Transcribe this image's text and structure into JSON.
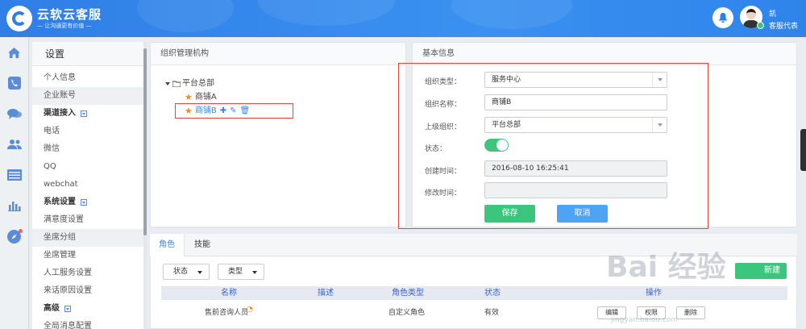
{
  "header": {
    "brand_title": "云软云客服",
    "brand_slogan": "— 让沟通更有价值 —",
    "user_name": "凯",
    "user_role": "客服代表"
  },
  "rail": {
    "icons": [
      "home-icon",
      "phone-icon",
      "chat-icon",
      "users-icon",
      "list-icon",
      "bar-chart-icon",
      "compass-icon"
    ]
  },
  "menu": {
    "title": "设置",
    "items": [
      {
        "label": "个人信息",
        "type": "item"
      },
      {
        "label": "企业账号",
        "type": "item",
        "active": true
      },
      {
        "label": "渠道接入",
        "type": "group"
      },
      {
        "label": "电话",
        "type": "item"
      },
      {
        "label": "微信",
        "type": "item"
      },
      {
        "label": "QQ",
        "type": "item"
      },
      {
        "label": "webchat",
        "type": "item"
      },
      {
        "label": "系统设置",
        "type": "group"
      },
      {
        "label": "满意度设置",
        "type": "item"
      },
      {
        "label": "坐席分组",
        "type": "item",
        "active": true
      },
      {
        "label": "坐席管理",
        "type": "item"
      },
      {
        "label": "人工服务设置",
        "type": "item"
      },
      {
        "label": "来话原因设置",
        "type": "item"
      },
      {
        "label": "高级",
        "type": "group"
      },
      {
        "label": "全局消息配置",
        "type": "item"
      }
    ]
  },
  "org_panel": {
    "title": "组织管理机构",
    "root": "平台总部",
    "child_a": "商铺A",
    "child_b": "商铺B"
  },
  "info_panel": {
    "title": "基本信息",
    "type_label": "组织类型：",
    "type_value": "服务中心",
    "name_label": "组织名称：",
    "name_value": "商铺B",
    "parent_label": "上级组织：",
    "parent_value": "平台总部",
    "status_label": "状态：",
    "status_on": true,
    "created_label": "创建时间：",
    "created_value": "2016-08-10 16:25:41",
    "modified_label": "修改时间：",
    "modified_value": "",
    "save_label": "保存",
    "cancel_label": "取消"
  },
  "roles": {
    "tab_roles": "角色",
    "tab_skills": "技能",
    "filter_status": "状态",
    "filter_type": "类型",
    "new_label": "新建",
    "columns": [
      "名称",
      "描述",
      "角色类型",
      "状态",
      "操作"
    ],
    "rows": [
      {
        "name": "售前咨询人员",
        "desc": "",
        "role_type": "自定义角色",
        "status": "有效",
        "actions": [
          "编辑",
          "权限",
          "删除"
        ]
      }
    ]
  },
  "watermark": {
    "text": "Bai 经验",
    "url": "jingyan.baidu.com"
  },
  "colors": {
    "brand_blue": "#2f7fe6",
    "link_blue": "#3a87e0",
    "save_green": "#3cc67d",
    "cancel_blue": "#4ea3f3",
    "highlight_red": "#e8453c",
    "star_orange": "#f08a24"
  }
}
